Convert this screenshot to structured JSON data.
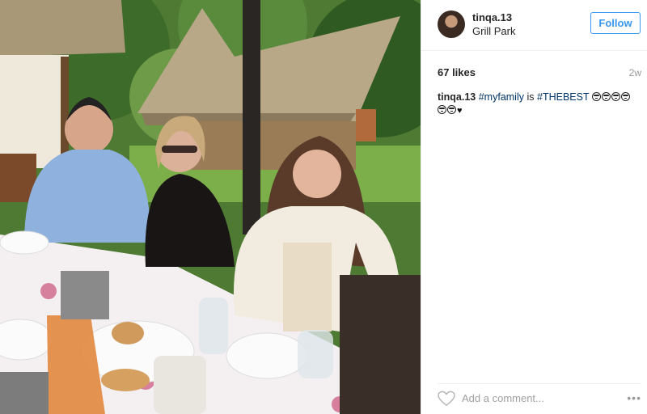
{
  "post": {
    "username": "tinqa.13",
    "location": "Grill Park",
    "follow_label": "Follow",
    "likes": "67 likes",
    "age": "2w",
    "caption": {
      "user": "tinqa.13",
      "tag1": "#myfamily",
      "word": "is",
      "tag2": "#THEBEST"
    },
    "emojis_line1": [
      "grimacing",
      "grimacing",
      "grimacing",
      "grimacing"
    ],
    "emojis_line2": [
      "grimacing",
      "grimacing",
      "black-heart"
    ],
    "heart_glyph": "♥",
    "comment_placeholder": "Add a comment...",
    "more_glyph": "•••"
  },
  "colors": {
    "accent": "#3897f0",
    "hashtag": "#003569",
    "muted": "#999999"
  }
}
